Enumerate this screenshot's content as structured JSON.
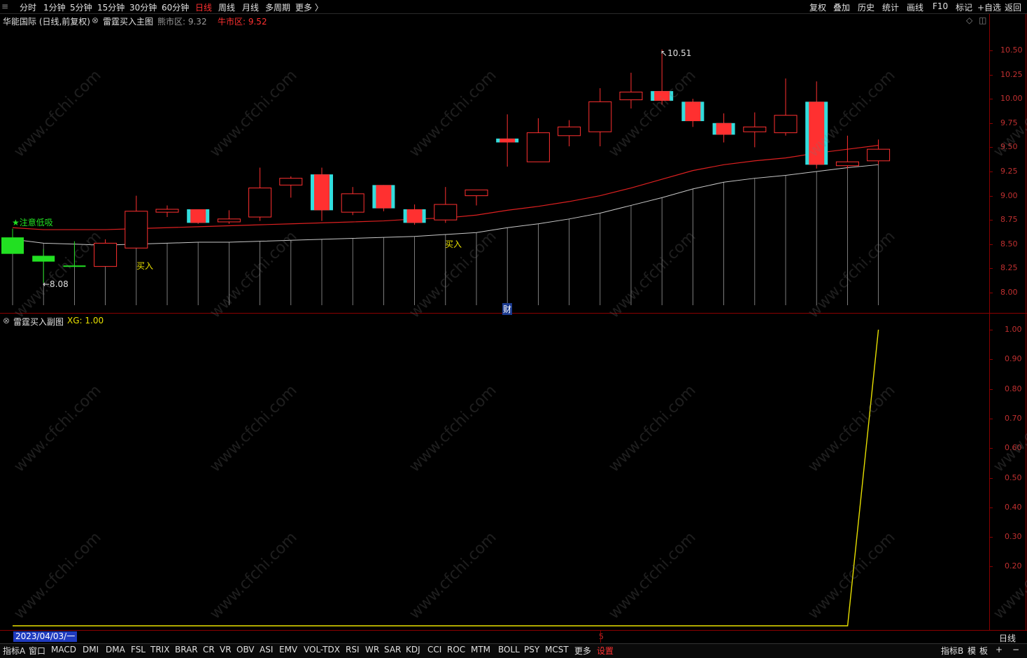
{
  "toolbar": {
    "periods": [
      "分时",
      "1分钟",
      "5分钟",
      "15分钟",
      "30分钟",
      "60分钟",
      "日线",
      "周线",
      "月线",
      "多周期",
      "更多 〉"
    ],
    "active_period": "日线",
    "right_buttons": [
      "复权",
      "叠加",
      "历史",
      "统计",
      "画线",
      "F10",
      "标记",
      "+自选",
      "返回"
    ]
  },
  "main_header": {
    "stock": "华能国际 (日线,前复权)",
    "indicator": "雷霆买入主图",
    "bear_label": "熊市区: 9.32",
    "bull_label": "牛市区: 9.52"
  },
  "sub_header": {
    "indicator": "雷霆买入副图",
    "xg_label": "XG: 1.00"
  },
  "annotations": {
    "high": "10.51",
    "low": "←8.08",
    "attention": "★注意低吸",
    "buy1": "买入",
    "buy2": "买入",
    "cai": "财"
  },
  "main_axis": [
    "10.50",
    "10.25",
    "10.00",
    "9.75",
    "9.50",
    "9.25",
    "9.00",
    "8.75",
    "8.50",
    "8.25",
    "8.00"
  ],
  "sub_axis": [
    "1.00",
    "0.90",
    "0.80",
    "0.70",
    "0.60",
    "0.50",
    "0.40",
    "0.30",
    "0.20"
  ],
  "date_label": "2023/04/03/一",
  "marker_5": "5",
  "period_label": "日线",
  "bottom_tabs": [
    "指标A",
    "窗口",
    "MACD",
    "DMI",
    "DMA",
    "FSL",
    "TRIX",
    "BRAR",
    "CR",
    "VR",
    "OBV",
    "ASI",
    "EMV",
    "VOL-TDX",
    "RSI",
    "WR",
    "SAR",
    "KDJ",
    "CCI",
    "ROC",
    "MTM",
    "BOLL",
    "PSY",
    "MCST",
    "更多",
    "设置"
  ],
  "bottom_right": [
    "指标B",
    "模",
    "板",
    "+",
    "−"
  ],
  "watermark": "www.cfchi.com",
  "colors": {
    "up": "#ff3030",
    "down": "#22e022",
    "cyan": "#33dddd",
    "yellow": "#e8e000",
    "axis": "#8b0000",
    "bull_line": "#dd2020",
    "bear_line": "#c8c8c8"
  },
  "chart_data": [
    {
      "type": "candlestick",
      "title": "雷霆买入主图",
      "ylim": [
        7.9,
        10.7
      ],
      "candles": [
        {
          "o": 8.57,
          "h": 8.66,
          "l": 8.4,
          "c": 8.4,
          "color": "green"
        },
        {
          "o": 8.38,
          "h": 8.45,
          "l": 8.1,
          "c": 8.32,
          "color": "green"
        },
        {
          "o": 8.28,
          "h": 8.53,
          "l": 8.27,
          "c": 8.28,
          "color": "green"
        },
        {
          "o": 8.27,
          "h": 8.55,
          "l": 8.27,
          "c": 8.51,
          "color": "red"
        },
        {
          "o": 8.46,
          "h": 9.0,
          "l": 8.46,
          "c": 8.84,
          "color": "red"
        },
        {
          "o": 8.83,
          "h": 8.9,
          "l": 8.78,
          "c": 8.86,
          "color": "red"
        },
        {
          "o": 8.86,
          "h": 8.86,
          "l": 8.71,
          "c": 8.72,
          "color": "redcyan"
        },
        {
          "o": 8.76,
          "h": 8.85,
          "l": 8.71,
          "c": 8.73,
          "color": "red"
        },
        {
          "o": 8.78,
          "h": 9.29,
          "l": 8.74,
          "c": 9.08,
          "color": "red"
        },
        {
          "o": 9.11,
          "h": 9.2,
          "l": 8.98,
          "c": 9.18,
          "color": "red"
        },
        {
          "o": 9.22,
          "h": 9.29,
          "l": 8.74,
          "c": 8.85,
          "color": "redcyan"
        },
        {
          "o": 8.83,
          "h": 9.09,
          "l": 8.8,
          "c": 9.02,
          "color": "red"
        },
        {
          "o": 9.11,
          "h": 9.11,
          "l": 8.84,
          "c": 8.87,
          "color": "redcyan"
        },
        {
          "o": 8.86,
          "h": 8.91,
          "l": 8.7,
          "c": 8.72,
          "color": "redcyan"
        },
        {
          "o": 8.75,
          "h": 9.09,
          "l": 8.72,
          "c": 8.91,
          "color": "red"
        },
        {
          "o": 9.0,
          "h": 9.06,
          "l": 8.9,
          "c": 9.06,
          "color": "red"
        },
        {
          "o": 9.59,
          "h": 9.84,
          "l": 9.3,
          "c": 9.55,
          "color": "redcyan"
        },
        {
          "o": 9.35,
          "h": 9.8,
          "l": 9.35,
          "c": 9.65,
          "color": "red"
        },
        {
          "o": 9.62,
          "h": 9.78,
          "l": 9.51,
          "c": 9.71,
          "color": "red"
        },
        {
          "o": 9.66,
          "h": 10.11,
          "l": 9.51,
          "c": 9.97,
          "color": "red"
        },
        {
          "o": 9.99,
          "h": 10.27,
          "l": 9.9,
          "c": 10.07,
          "color": "red"
        },
        {
          "o": 10.08,
          "h": 10.51,
          "l": 9.94,
          "c": 9.98,
          "color": "redcyan"
        },
        {
          "o": 9.97,
          "h": 10.0,
          "l": 9.71,
          "c": 9.77,
          "color": "redcyan"
        },
        {
          "o": 9.75,
          "h": 9.85,
          "l": 9.55,
          "c": 9.63,
          "color": "redcyan"
        },
        {
          "o": 9.66,
          "h": 9.86,
          "l": 9.5,
          "c": 9.71,
          "color": "red"
        },
        {
          "o": 9.65,
          "h": 10.21,
          "l": 9.62,
          "c": 9.83,
          "color": "red"
        },
        {
          "o": 9.97,
          "h": 10.18,
          "l": 9.28,
          "c": 9.32,
          "color": "redcyan"
        },
        {
          "o": 9.35,
          "h": 9.62,
          "l": 9.28,
          "c": 9.31,
          "color": "red"
        },
        {
          "o": 9.36,
          "h": 9.58,
          "l": 9.32,
          "c": 9.48,
          "color": "red"
        }
      ],
      "bull_line": [
        8.67,
        8.65,
        8.65,
        8.65,
        8.66,
        8.67,
        8.68,
        8.69,
        8.7,
        8.71,
        8.72,
        8.73,
        8.74,
        8.76,
        8.77,
        8.8,
        8.85,
        8.89,
        8.94,
        9.0,
        9.08,
        9.17,
        9.26,
        9.32,
        9.36,
        9.39,
        9.44,
        9.48,
        9.52
      ],
      "bear_line": [
        8.55,
        8.51,
        8.5,
        8.49,
        8.5,
        8.51,
        8.52,
        8.52,
        8.53,
        8.54,
        8.55,
        8.56,
        8.57,
        8.58,
        8.6,
        8.62,
        8.67,
        8.71,
        8.76,
        8.82,
        8.9,
        8.98,
        9.07,
        9.14,
        9.18,
        9.21,
        9.25,
        9.29,
        9.32
      ]
    },
    {
      "type": "line",
      "title": "雷霆买入副图",
      "ylim": [
        0,
        1.05
      ],
      "series": [
        {
          "name": "XG",
          "values": [
            0,
            0,
            0,
            0,
            0,
            0,
            0,
            0,
            0,
            0,
            0,
            0,
            0,
            0,
            0,
            0,
            0,
            0,
            0,
            0,
            0,
            0,
            0,
            0,
            0,
            0,
            0,
            0,
            1.0
          ]
        }
      ]
    }
  ]
}
